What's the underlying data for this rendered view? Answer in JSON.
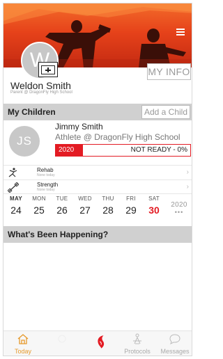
{
  "header": {
    "avatar_initial": "W",
    "my_info_label": "MY INFO",
    "parent_name": "Weldon Smith",
    "parent_subtitle": "Parent @ DragonFly High School"
  },
  "my_children": {
    "title": "My Children",
    "add_child_label": "Add a Child"
  },
  "child": {
    "initials": "JS",
    "name": "Jimmy Smith",
    "subtitle": "Athlete @ DragonFly High School",
    "year": "2020",
    "status": "NOT READY - 0%",
    "readiness": 0.2
  },
  "programs": [
    {
      "title": "Rehab",
      "subtitle": "None today"
    },
    {
      "title": "Strength",
      "subtitle": "None today"
    }
  ],
  "week": {
    "days": [
      {
        "name": "MAY",
        "date": "24"
      },
      {
        "name": "MON",
        "date": "25"
      },
      {
        "name": "TUE",
        "date": "26"
      },
      {
        "name": "WED",
        "date": "27"
      },
      {
        "name": "THU",
        "date": "28"
      },
      {
        "name": "FRI",
        "date": "29"
      },
      {
        "name": "SAT",
        "date": "30"
      }
    ],
    "year": "2020",
    "more": "•••"
  },
  "happening": {
    "title": "What's Been Happening?"
  },
  "tabs": [
    {
      "label": "Today",
      "icon": "home-icon"
    },
    {
      "label": "",
      "icon": "blank-icon"
    },
    {
      "label": "",
      "icon": "dragonfly-logo-icon"
    },
    {
      "label": "Protocols",
      "icon": "protocols-icon"
    },
    {
      "label": "Messages",
      "icon": "chat-bubble-icon"
    }
  ],
  "colors": {
    "accent": "#e31b23",
    "active_tab": "#e69a2c",
    "section_bar": "#d0d0d0"
  }
}
